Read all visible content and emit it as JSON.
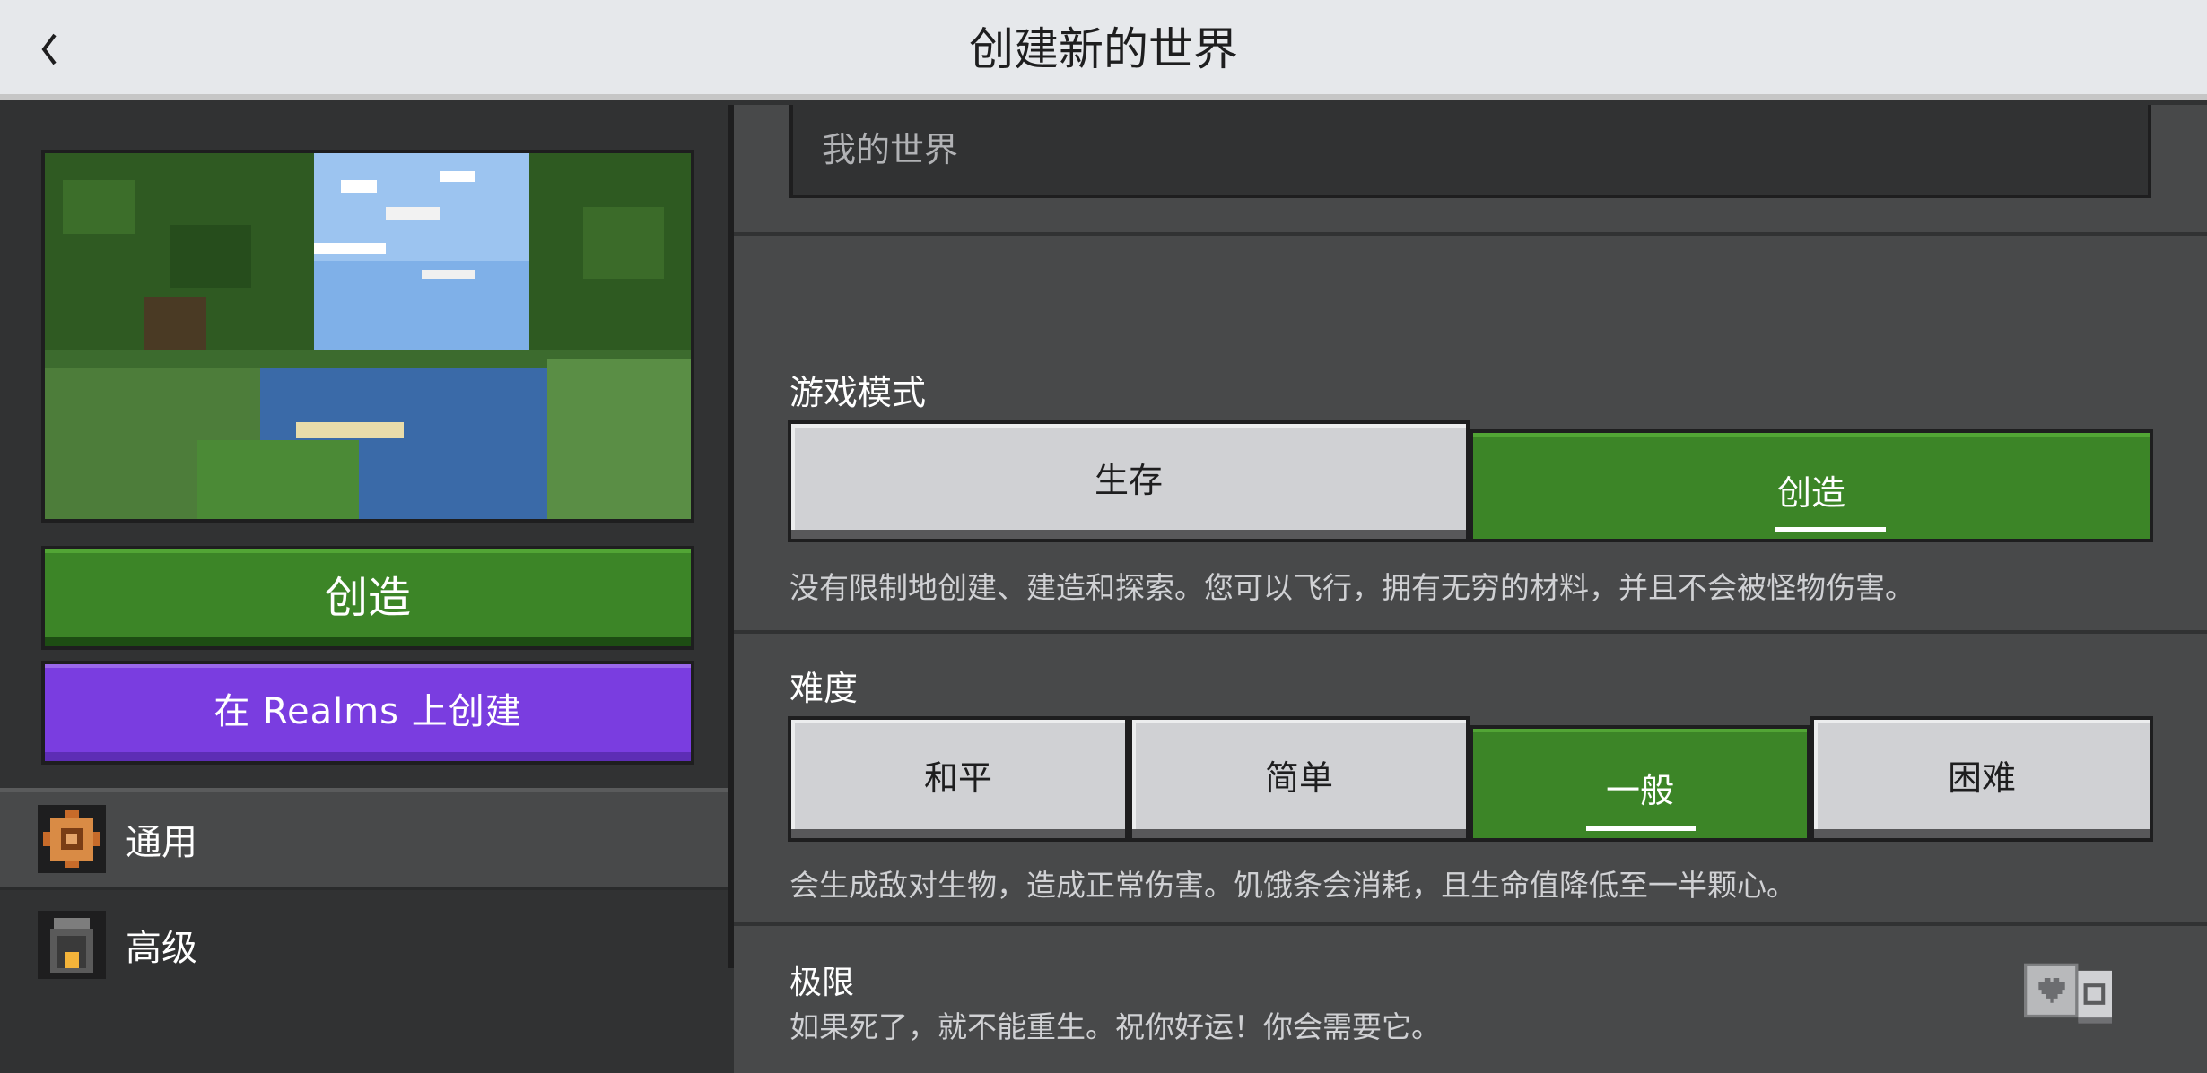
{
  "header": {
    "title": "创建新的世界"
  },
  "left_panel": {
    "create_button": "创造",
    "realms_button": "在 Realms 上创建",
    "nav": [
      {
        "label": "通用",
        "icon": "gear-icon"
      },
      {
        "label": "高级",
        "icon": "lantern-icon"
      }
    ]
  },
  "world_name": {
    "value": "我的世界"
  },
  "game_mode": {
    "title": "游戏模式",
    "options": [
      "生存",
      "创造"
    ],
    "selected": "创造",
    "description": "没有限制地创建、建造和探索。您可以飞行，拥有无穷的材料，并且不会被怪物伤害。"
  },
  "difficulty": {
    "title": "难度",
    "options": [
      "和平",
      "简单",
      "一般",
      "困难"
    ],
    "selected": "一般",
    "description": "会生成敌对生物，造成正常伤害。饥饿条会消耗，且生命值降低至一半颗心。"
  },
  "hardcore": {
    "title": "极限",
    "description": "如果死了，就不能重生。祝你好运！你会需要它。",
    "enabled": false
  },
  "colors": {
    "selected_green": "#3c8527",
    "realms_purple": "#7a3de0",
    "panel_gray": "#48494a",
    "header_bg": "#e6e8eb"
  }
}
